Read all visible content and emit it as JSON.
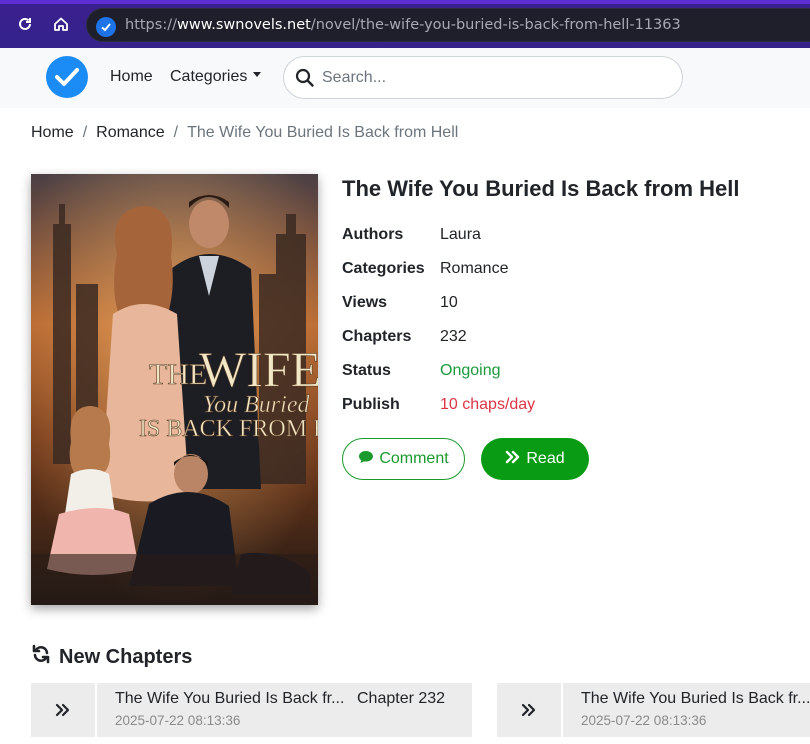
{
  "browser": {
    "url_scheme": "https://",
    "url_host": "www.swnovels.net",
    "url_path": "/novel/the-wife-you-buried-is-back-from-hell-11363"
  },
  "navbar": {
    "home": "Home",
    "categories": "Categories",
    "search_placeholder": "Search..."
  },
  "breadcrumb": {
    "home": "Home",
    "category": "Romance",
    "current": "The Wife You Buried Is Back from Hell"
  },
  "cover": {
    "title_line1": "THE",
    "title_line2": "WIFE",
    "title_line3": "You Buried",
    "title_line4": "IS BACK FROM HELL"
  },
  "novel": {
    "title": "The Wife You Buried Is Back from Hell",
    "info": [
      {
        "key": "Authors",
        "value": "Laura",
        "tone": ""
      },
      {
        "key": "Categories",
        "value": "Romance",
        "tone": ""
      },
      {
        "key": "Views",
        "value": "10",
        "tone": ""
      },
      {
        "key": "Chapters",
        "value": "232",
        "tone": ""
      },
      {
        "key": "Status",
        "value": "Ongoing",
        "tone": "green"
      },
      {
        "key": "Publish",
        "value": "10 chaps/day",
        "tone": "red"
      }
    ],
    "comment_label": "Comment",
    "read_label": "Read"
  },
  "new_chapters": {
    "heading": "New Chapters",
    "items": [
      {
        "title": "The Wife You Buried Is Back fr...",
        "chapter": "Chapter 232",
        "date": "2025-07-22 08:13:36"
      },
      {
        "title": "The Wife You Buried Is Back fr...",
        "chapter": "",
        "date": "2025-07-22 08:13:36"
      }
    ]
  },
  "colors": {
    "browser_bar": "#35238a",
    "accent_green": "#0a9b14",
    "status_green": "#1c9a3b",
    "publish_red": "#dc3545",
    "logo_blue": "#1b8cf5"
  }
}
